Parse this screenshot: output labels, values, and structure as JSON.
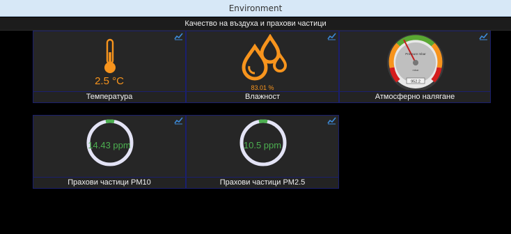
{
  "window": {
    "title": "Environment"
  },
  "header": {
    "subtitle": "Качество на въздуха и прахови частици"
  },
  "tiles": {
    "temperature": {
      "value": "2.5 °C",
      "label": "Температура"
    },
    "humidity": {
      "value": "83.01 %",
      "value_fraction": 0.8301,
      "label": "Влажност"
    },
    "pressure": {
      "value": "952.2",
      "label": "Атмосферно налягане",
      "unit": "mbar",
      "gauge_title": "Pressure mbar"
    },
    "pm10": {
      "value": "14.43 ppm",
      "label": "Прахови частици PM10"
    },
    "pm25": {
      "value": "10.5 ppm",
      "label": "Прахови частици PM2.5"
    }
  },
  "colors": {
    "accent": "#f7941d",
    "ok": "#4caf50",
    "link": "#3d8bd9",
    "ring": "#e3e3f5"
  },
  "icons": [
    "thermometer-icon",
    "water-drops-icon",
    "chart-line-icon"
  ]
}
